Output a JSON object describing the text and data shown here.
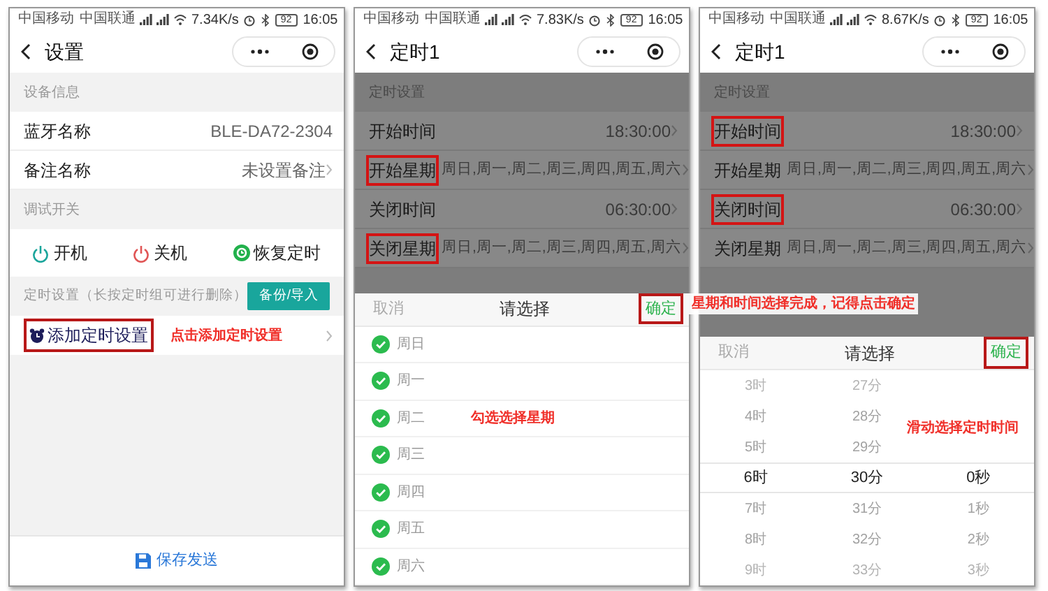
{
  "screens": [
    {
      "kind": "settings",
      "status": {
        "carriers": [
          "中国移动",
          "中国联通"
        ],
        "speed": "7.34K/s",
        "battery": "92",
        "time": "16:05"
      },
      "title": "设置",
      "sections": [
        {
          "kind": "info",
          "label": "设备信息",
          "rows": [
            {
              "label": "蓝牙名称",
              "value": "BLE-DA72-2304",
              "chevron": false
            },
            {
              "label": "备注名称",
              "value": "未设置备注",
              "chevron": true
            }
          ]
        },
        {
          "kind": "switches",
          "label": "调试开关",
          "buttons": [
            {
              "label": "开机",
              "kind": "power",
              "color": "#1aa59b"
            },
            {
              "label": "关机",
              "kind": "power",
              "color": "#e05555"
            },
            {
              "label": "恢复定时",
              "kind": "restore",
              "color": "#22b14c"
            }
          ]
        },
        {
          "kind": "timers",
          "label": "定时设置（长按定时组可进行删除）",
          "action": "备份/导入",
          "rows": [
            {
              "label": "添加定时设置",
              "note": "点击添加定时设置",
              "highlighted": true
            }
          ]
        }
      ],
      "footer": "保存发送"
    },
    {
      "kind": "weekday",
      "status": {
        "carriers": [
          "中国移动",
          "中国联通"
        ],
        "speed": "7.83K/s",
        "battery": "92",
        "time": "16:05"
      },
      "title": "定时1",
      "dimmed": true,
      "section_label": "定时设置",
      "rows": [
        {
          "label": "开始时间",
          "value": "18:30:00",
          "highlighted": false
        },
        {
          "label": "开始星期",
          "value": "周日,周一,周二,周三,周四,周五,周六",
          "highlighted": true
        },
        {
          "label": "关闭时间",
          "value": "06:30:00",
          "highlighted": false
        },
        {
          "label": "关闭星期",
          "value": "周日,周一,周二,周三,周四,周五,周六",
          "highlighted": true
        }
      ],
      "picker": {
        "cancel": "取消",
        "title": "请选择",
        "confirm": "确定",
        "confirm_highlighted": true,
        "days": [
          {
            "label": "周日",
            "checked": true
          },
          {
            "label": "周一",
            "checked": true
          },
          {
            "label": "周二",
            "checked": true,
            "note": "勾选选择星期"
          },
          {
            "label": "周三",
            "checked": true
          },
          {
            "label": "周四",
            "checked": true
          },
          {
            "label": "周五",
            "checked": true
          },
          {
            "label": "周六",
            "checked": true
          }
        ]
      }
    },
    {
      "kind": "time",
      "status": {
        "carriers": [
          "中国移动",
          "中国联通"
        ],
        "speed": "8.67K/s",
        "battery": "92",
        "time": "16:05"
      },
      "title": "定时1",
      "dimmed": true,
      "section_label": "定时设置",
      "rows": [
        {
          "label": "开始时间",
          "value": "18:30:00",
          "highlighted": true
        },
        {
          "label": "开始星期",
          "value": "周日,周一,周二,周三,周四,周五,周六",
          "highlighted": false
        },
        {
          "label": "关闭时间",
          "value": "06:30:00",
          "highlighted": true
        },
        {
          "label": "关闭星期",
          "value": "周日,周一,周二,周三,周四,周五,周六",
          "highlighted": false
        }
      ],
      "picker": {
        "cancel": "取消",
        "title": "请选择",
        "confirm": "确定",
        "confirm_highlighted": true,
        "note": "滑动选择定时时间",
        "columns": [
          {
            "items": [
              {
                "label": "3时",
                "selected": false
              },
              {
                "label": "4时",
                "selected": false
              },
              {
                "label": "5时",
                "selected": false
              },
              {
                "label": "6时",
                "selected": true
              },
              {
                "label": "7时",
                "selected": false
              },
              {
                "label": "8时",
                "selected": false
              },
              {
                "label": "9时",
                "selected": false
              }
            ]
          },
          {
            "items": [
              {
                "label": "27分",
                "selected": false
              },
              {
                "label": "28分",
                "selected": false
              },
              {
                "label": "29分",
                "selected": false
              },
              {
                "label": "30分",
                "selected": true
              },
              {
                "label": "31分",
                "selected": false
              },
              {
                "label": "32分",
                "selected": false
              },
              {
                "label": "33分",
                "selected": false
              }
            ]
          },
          {
            "items": [
              {
                "label": "0秒",
                "selected": true
              },
              {
                "label": "1秒",
                "selected": false
              },
              {
                "label": "2秒",
                "selected": false
              },
              {
                "label": "3秒",
                "selected": false
              }
            ]
          }
        ]
      }
    }
  ],
  "annotations": [
    {
      "text": "星期和时间选择完成，记得点击确定"
    }
  ]
}
